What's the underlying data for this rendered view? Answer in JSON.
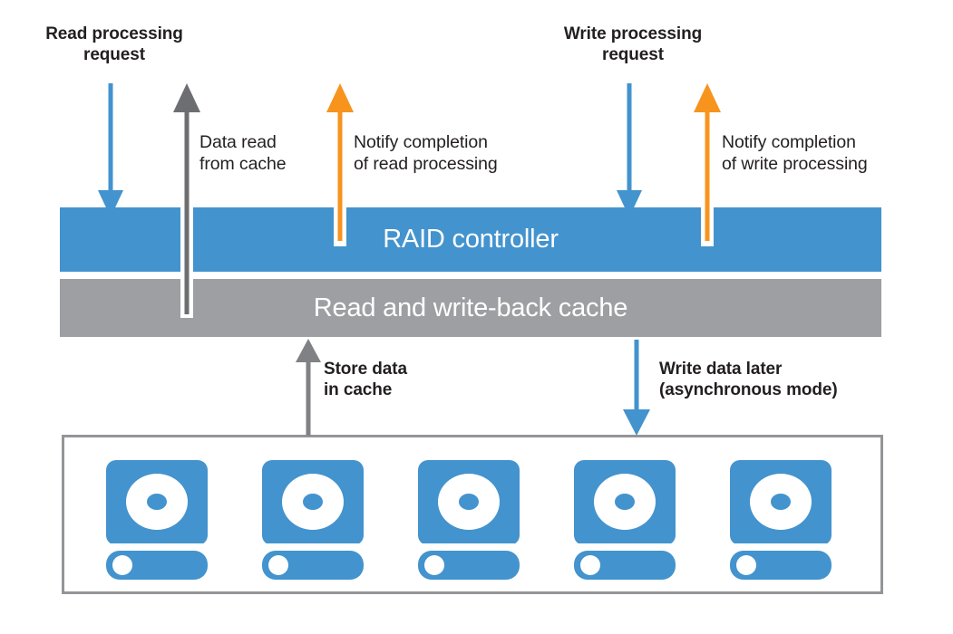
{
  "diagram": {
    "title_hidden": "",
    "colors": {
      "blue": "#4393ce",
      "gray": "#9d9fa2",
      "dark_gray": "#6d6e71",
      "orange": "#f7941e",
      "text": "#231f20",
      "frame": "#939598",
      "white": "#ffffff"
    },
    "bars": [
      {
        "id": "raid-controller",
        "label": "RAID controller",
        "fill": "#4393ce"
      },
      {
        "id": "cache",
        "label": "Read and write-back cache",
        "fill": "#9d9fa2"
      }
    ],
    "labels": [
      {
        "id": "read-processing-request",
        "text": "Read processing\nrequest",
        "weight": "bold",
        "align": "center"
      },
      {
        "id": "write-processing-request",
        "text": "Write processing\nrequest",
        "weight": "bold",
        "align": "center"
      },
      {
        "id": "data-read-from-cache",
        "text": "Data read\nfrom cache",
        "weight": "plain",
        "align": "left"
      },
      {
        "id": "notify-read-completion",
        "text": "Notify completion\nof read processing",
        "weight": "plain",
        "align": "left"
      },
      {
        "id": "notify-write-completion",
        "text": "Notify completion\nof write processing",
        "weight": "plain",
        "align": "left"
      },
      {
        "id": "store-data-in-cache",
        "text": "Store data\nin cache",
        "weight": "bold",
        "align": "left"
      },
      {
        "id": "write-data-later",
        "text": "Write data later\n(asynchronous mode)",
        "weight": "bold",
        "align": "left"
      }
    ],
    "arrows": [
      {
        "id": "read-request-arrow",
        "color": "#4393ce",
        "direction": "down",
        "label_ref": "read-processing-request"
      },
      {
        "id": "data-read-arrow",
        "color": "#6d6e71",
        "direction": "up",
        "label_ref": "data-read-from-cache"
      },
      {
        "id": "notify-read-arrow",
        "color": "#f7941e",
        "direction": "up",
        "label_ref": "notify-read-completion"
      },
      {
        "id": "write-request-arrow",
        "color": "#4393ce",
        "direction": "down",
        "label_ref": "write-processing-request"
      },
      {
        "id": "notify-write-arrow",
        "color": "#f7941e",
        "direction": "up",
        "label_ref": "notify-write-completion"
      },
      {
        "id": "store-data-arrow",
        "color": "#6d6e71",
        "direction": "up",
        "label_ref": "store-data-in-cache"
      },
      {
        "id": "write-later-arrow",
        "color": "#4393ce",
        "direction": "down",
        "label_ref": "write-data-later"
      }
    ],
    "disk_array": {
      "count": 5,
      "icon": "hard-disk-drive-icon"
    }
  }
}
